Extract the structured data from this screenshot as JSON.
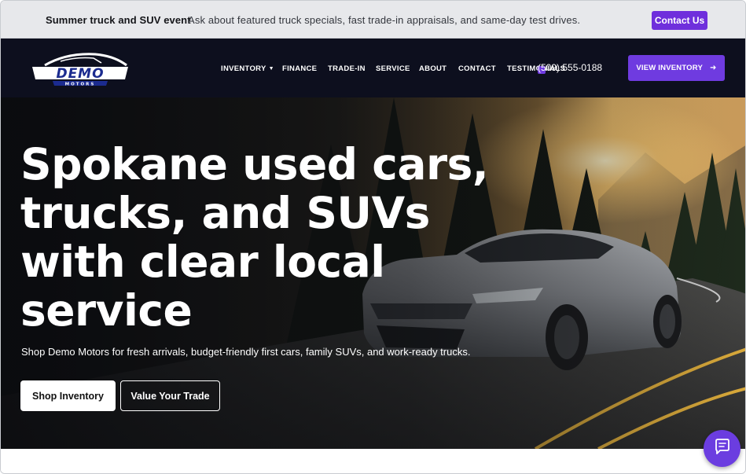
{
  "announcement": {
    "title": "Summer truck and SUV event",
    "message": "Ask about featured truck specials, fast trade-in appraisals, and same-day test drives.",
    "contact_label": "Contact Us"
  },
  "brand": {
    "logo_top": "DEMO",
    "logo_bottom": "MOTORS",
    "accent": "#6f3be0"
  },
  "nav": {
    "items": [
      {
        "label": "INVENTORY",
        "has_dropdown": true
      },
      {
        "label": "FINANCE"
      },
      {
        "label": "TRADE-IN"
      },
      {
        "label": "SERVICE"
      },
      {
        "label": "ABOUT"
      },
      {
        "label": "CONTACT"
      },
      {
        "label": "TESTIMONIALS"
      }
    ],
    "phone": "(509) 555-0188",
    "cta_label": "VIEW INVENTORY"
  },
  "hero": {
    "title": "Spokane used cars, trucks, and SUVs with clear local service",
    "subtitle": "Shop Demo Motors for fresh arrivals, budget-friendly first cars, family SUVs, and work-ready trucks.",
    "primary_label": "Shop Inventory",
    "secondary_label": "Value Your Trade"
  },
  "icons": {
    "chat": "chat-bubble-icon",
    "phone": "phone-icon",
    "arrow": "arrow-right-icon",
    "caret": "chevron-down-icon"
  }
}
